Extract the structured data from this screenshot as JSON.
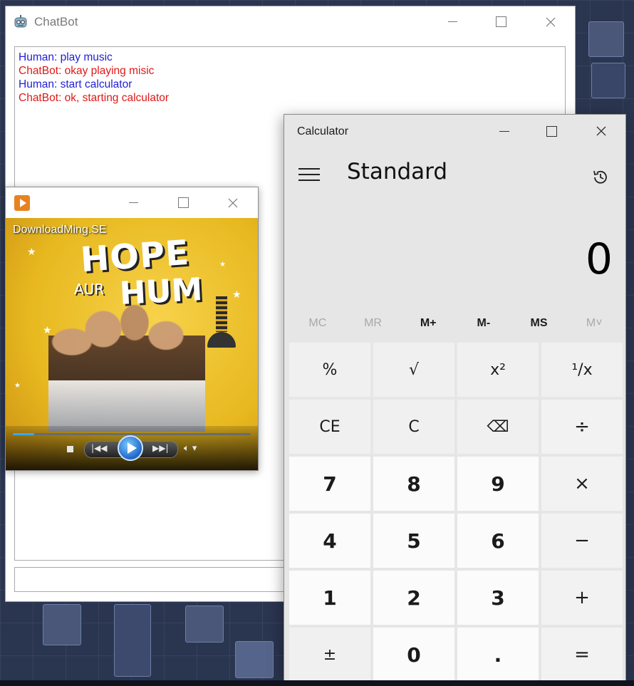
{
  "chatbot": {
    "title": "ChatBot",
    "messages": [
      {
        "text": "Human: play music",
        "role": "human"
      },
      {
        "text": "ChatBot: okay playing misic",
        "role": "bot"
      },
      {
        "text": "Human: start calculator",
        "role": "human"
      },
      {
        "text": "ChatBot: ok, starting calculator",
        "role": "bot"
      }
    ],
    "input_value": ""
  },
  "media_player": {
    "caption": "DownloadMing.SE",
    "poster": {
      "title_line1": "HOPE",
      "title_line2": "AUR",
      "title_line3": "HUM"
    },
    "progress": 0.09
  },
  "calculator": {
    "title": "Calculator",
    "mode": "Standard",
    "display": "0",
    "memory": [
      {
        "label": "MC",
        "enabled": false
      },
      {
        "label": "MR",
        "enabled": false
      },
      {
        "label": "M+",
        "enabled": true
      },
      {
        "label": "M-",
        "enabled": true
      },
      {
        "label": "MS",
        "enabled": true
      },
      {
        "label": "M˅",
        "enabled": false
      }
    ],
    "keys": [
      {
        "label": "%",
        "kind": "fn",
        "name": "percent"
      },
      {
        "label": "√",
        "kind": "fn",
        "name": "sqrt"
      },
      {
        "label": "x²",
        "kind": "fn",
        "name": "square"
      },
      {
        "label": "¹/x",
        "kind": "fn",
        "name": "reciprocal"
      },
      {
        "label": "CE",
        "kind": "fn",
        "name": "clear-entry"
      },
      {
        "label": "C",
        "kind": "fn",
        "name": "clear"
      },
      {
        "label": "⌫",
        "kind": "fn",
        "name": "backspace"
      },
      {
        "label": "÷",
        "kind": "op",
        "name": "divide"
      },
      {
        "label": "7",
        "kind": "num",
        "name": "7"
      },
      {
        "label": "8",
        "kind": "num",
        "name": "8"
      },
      {
        "label": "9",
        "kind": "num",
        "name": "9"
      },
      {
        "label": "×",
        "kind": "op",
        "name": "multiply"
      },
      {
        "label": "4",
        "kind": "num",
        "name": "4"
      },
      {
        "label": "5",
        "kind": "num",
        "name": "5"
      },
      {
        "label": "6",
        "kind": "num",
        "name": "6"
      },
      {
        "label": "−",
        "kind": "op",
        "name": "subtract"
      },
      {
        "label": "1",
        "kind": "num",
        "name": "1"
      },
      {
        "label": "2",
        "kind": "num",
        "name": "2"
      },
      {
        "label": "3",
        "kind": "num",
        "name": "3"
      },
      {
        "label": "+",
        "kind": "op",
        "name": "add"
      },
      {
        "label": "±",
        "kind": "fn",
        "name": "negate"
      },
      {
        "label": "0",
        "kind": "num",
        "name": "0"
      },
      {
        "label": ".",
        "kind": "num",
        "name": "decimal"
      },
      {
        "label": "=",
        "kind": "op",
        "name": "equals"
      }
    ]
  },
  "icons": {
    "minimize": "minimize-icon",
    "maximize": "maximize-icon",
    "close": "close-icon",
    "history": "history-icon",
    "menu": "hamburger-menu-icon"
  },
  "colors": {
    "human": "#1e1ed6",
    "bot": "#e01818",
    "play_button": "#1f67c9",
    "seek_fill": "#39a7ff"
  }
}
